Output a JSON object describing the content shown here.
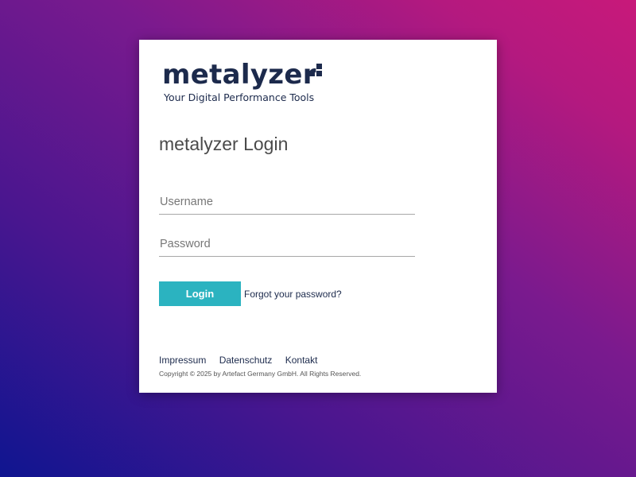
{
  "brand": {
    "name": "metalyzer",
    "tagline": "Your Digital Performance Tools",
    "color": "#1c2a4c"
  },
  "login": {
    "title": "metalyzer Login",
    "username_placeholder": "Username",
    "password_placeholder": "Password",
    "login_label": "Login",
    "forgot_label": "Forgot your password?",
    "button_color": "#2bb3c0"
  },
  "footer": {
    "links": [
      "Impressum",
      "Datenschutz",
      "Kontakt"
    ],
    "copyright": "Copyright © 2025 by Artefact Germany GmbH. All Rights Reserved."
  }
}
